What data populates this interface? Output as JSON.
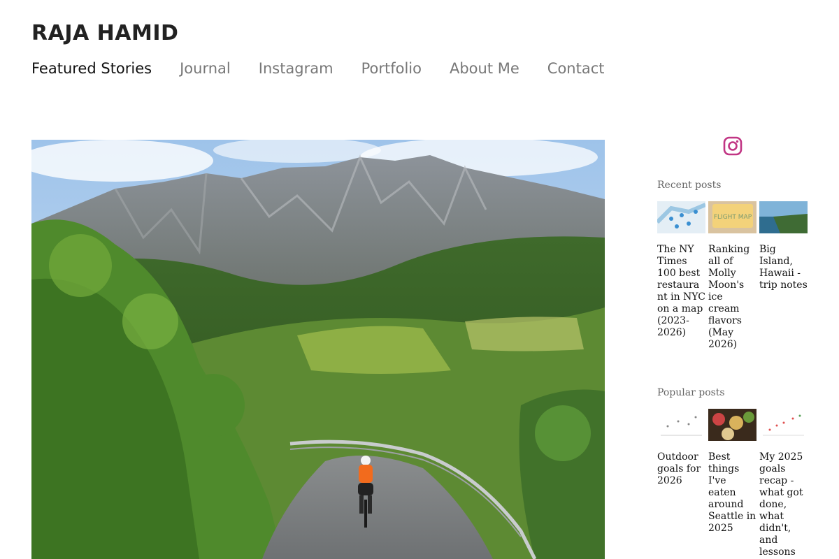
{
  "site": {
    "title": "RAJA HAMID"
  },
  "nav": {
    "items": [
      {
        "label": "Featured Stories",
        "active": true
      },
      {
        "label": "Journal"
      },
      {
        "label": "Instagram"
      },
      {
        "label": "Portfolio"
      },
      {
        "label": "About Me"
      },
      {
        "label": "Contact"
      }
    ]
  },
  "sidebar": {
    "instagram_icon": "instagram-icon",
    "accent_color": "#c13584",
    "recent": {
      "title": "Recent posts",
      "posts": [
        {
          "title": "The NY Times 100 best restaurant in NYC on a map (2023-2026)"
        },
        {
          "title": "Ranking all of Molly Moon's ice cream flavors (May 2026)"
        },
        {
          "title": "Big Island, Hawaii - trip notes"
        }
      ]
    },
    "popular": {
      "title": "Popular posts",
      "posts": [
        {
          "title": "Outdoor goals for 2026"
        },
        {
          "title": "Best things I've eaten around Seattle in 2025"
        },
        {
          "title": "My 2025 goals recap - what got done, what didn't, and lessons"
        }
      ]
    }
  }
}
